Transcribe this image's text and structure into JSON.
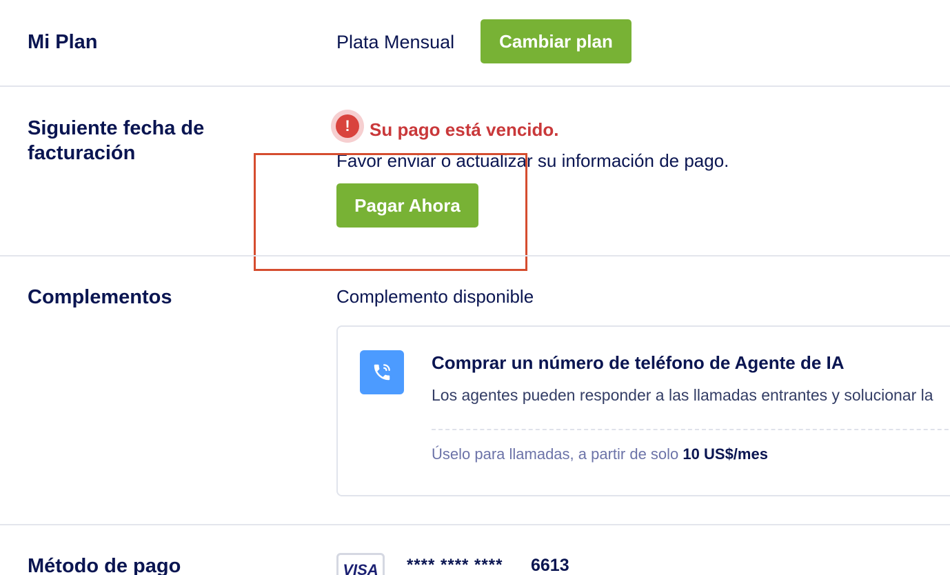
{
  "plan": {
    "label": "Mi Plan",
    "name": "Plata Mensual",
    "change_button": "Cambiar plan"
  },
  "billing": {
    "label": "Siguiente fecha de facturación",
    "alert_title": "Su pago está vencido.",
    "alert_message": "Favor enviar o actualizar su información de pago.",
    "pay_button": "Pagar Ahora"
  },
  "addons": {
    "label": "Complementos",
    "available": "Complemento disponible",
    "card": {
      "icon": "phone-call-icon",
      "title": "Comprar un número de teléfono de Agente de IA",
      "description": "Los agentes pueden responder a las llamadas entrantes y solucionar la",
      "price_prefix": "Úselo para llamadas, a partir de solo ",
      "price_value": "10 US$/mes"
    }
  },
  "payment": {
    "label": "Método de pago",
    "card_brand": "VISA",
    "card_masked": "**** **** ****",
    "card_last4": "6613"
  },
  "colors": {
    "primary_text": "#0a1551",
    "green_button": "#78b235",
    "alert_red": "#c9383a",
    "highlight_border": "#d54d2f",
    "phone_icon_bg": "#4c9bff"
  }
}
